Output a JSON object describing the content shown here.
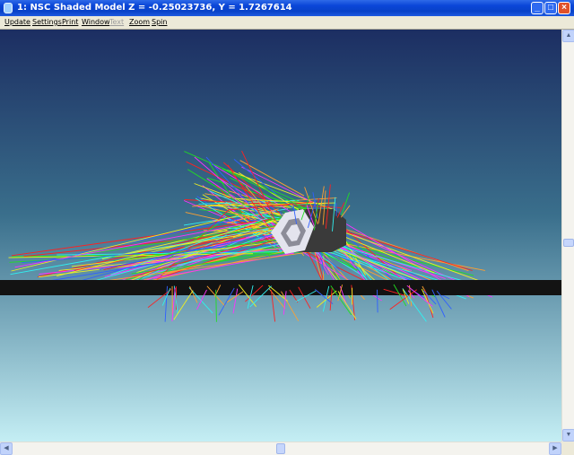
{
  "window": {
    "title": "1: NSC Shaded Model Z = -0.25023736, Y = 1.7267614",
    "controls": {
      "minimize": "_",
      "maximize": "□",
      "close": "×"
    }
  },
  "menu": {
    "items": [
      {
        "label": "Update",
        "enabled": true
      },
      {
        "label": "Settings",
        "enabled": true
      },
      {
        "label": "Print",
        "enabled": true
      },
      {
        "label": "Window",
        "enabled": true
      },
      {
        "label": "Text",
        "enabled": false
      },
      {
        "label": "Zoom",
        "enabled": true
      },
      {
        "label": "Spin",
        "enabled": true
      }
    ]
  },
  "viewport": {
    "background_top": "#1c2e62",
    "background_bottom": "#c4eef4",
    "detector_color": "#131313",
    "object_face_color": "#e4e4ee",
    "object_shadow_color": "#3a3a3a",
    "ray_colors": [
      "#ff2020",
      "#20e020",
      "#f0f020",
      "#ff30ff",
      "#3060ff",
      "#30f0f0",
      "#ffa030"
    ]
  },
  "scrollbars": {
    "vertical_icons": [
      "arrow-up-icon",
      "arrow-down-icon"
    ],
    "horizontal_icons": [
      "arrow-left-icon",
      "arrow-right-icon"
    ],
    "vertical_position": 0.52,
    "horizontal_position": 0.5
  }
}
